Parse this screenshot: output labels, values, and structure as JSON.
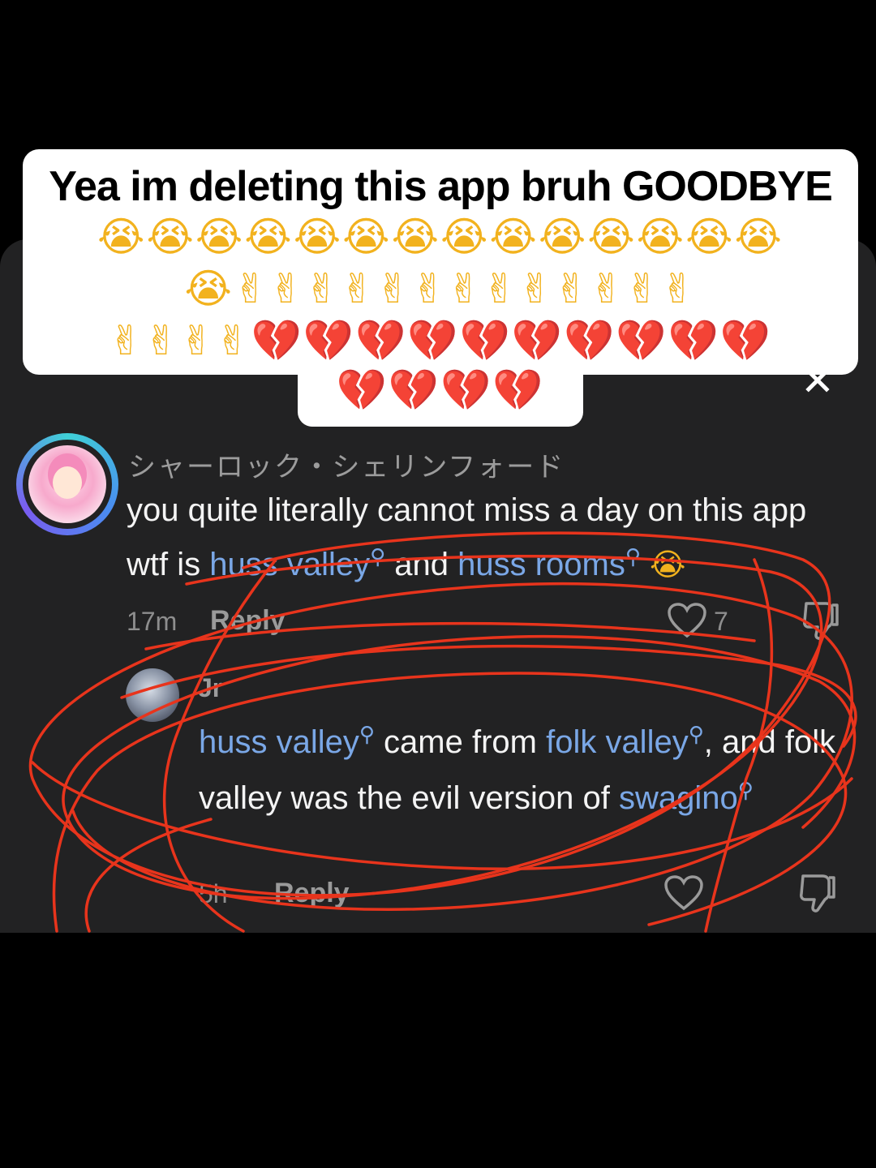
{
  "overlay_caption": {
    "title": "Yea im deleting this app bruh GOODBYE",
    "emoji_row_1": "😭😭😭😭😭😭😭😭😭😭😭😭😭😭",
    "emoji_row_2": "😭✌✌✌✌✌✌✌✌✌✌✌✌✌",
    "emoji_row_3_peace": "✌✌✌✌",
    "emoji_row_3_hearts": "💔💔💔💔💔💔💔💔💔💔",
    "emoji_row_4": "💔💔💔💔"
  },
  "close_button": {
    "icon": "close-icon",
    "glyph": "✕"
  },
  "comment": {
    "username": "シャーロック・シェリンフォード",
    "text_part1": "you quite literally cannot miss a day on this app wtf is ",
    "link1": "huss valley",
    "text_part2": " and ",
    "link2": "huss rooms",
    "emoji": "😭",
    "time": "17m",
    "reply_label": "Reply",
    "like_count": "7"
  },
  "reply": {
    "username": "Jr",
    "link1": "huss valley",
    "text_part1": " came from ",
    "link2": "folk valley",
    "text_part2": ", and folk valley was the evil version of ",
    "link3": "swagino",
    "time": "5h",
    "reply_label": "Reply"
  },
  "search_glyph": "⚲",
  "colors": {
    "background": "#000000",
    "sheet": "#222223",
    "link": "#7aa7e6",
    "scribble": "#e8341c",
    "caption_bg": "#ffffff"
  }
}
